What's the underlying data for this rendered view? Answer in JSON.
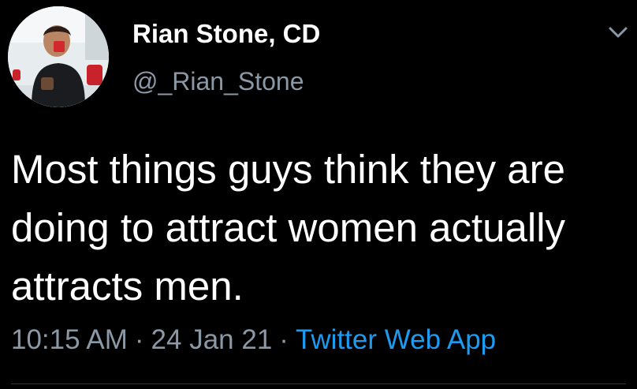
{
  "tweet": {
    "author": {
      "display_name": "Rian Stone, CD",
      "handle": "@_Rian_Stone",
      "avatar": "profile-photo"
    },
    "text": "Most things guys think they are doing to attract women actually attracts men.",
    "time": "10:15 AM",
    "date": "24 Jan 21",
    "separator": "·",
    "source": "Twitter Web App",
    "menu_icon": "chevron-down-icon"
  },
  "colors": {
    "background": "#000000",
    "primary_text": "#ffffff",
    "secondary_text": "#8b98a5",
    "link": "#1d9bf0",
    "divider": "#2f3336"
  }
}
